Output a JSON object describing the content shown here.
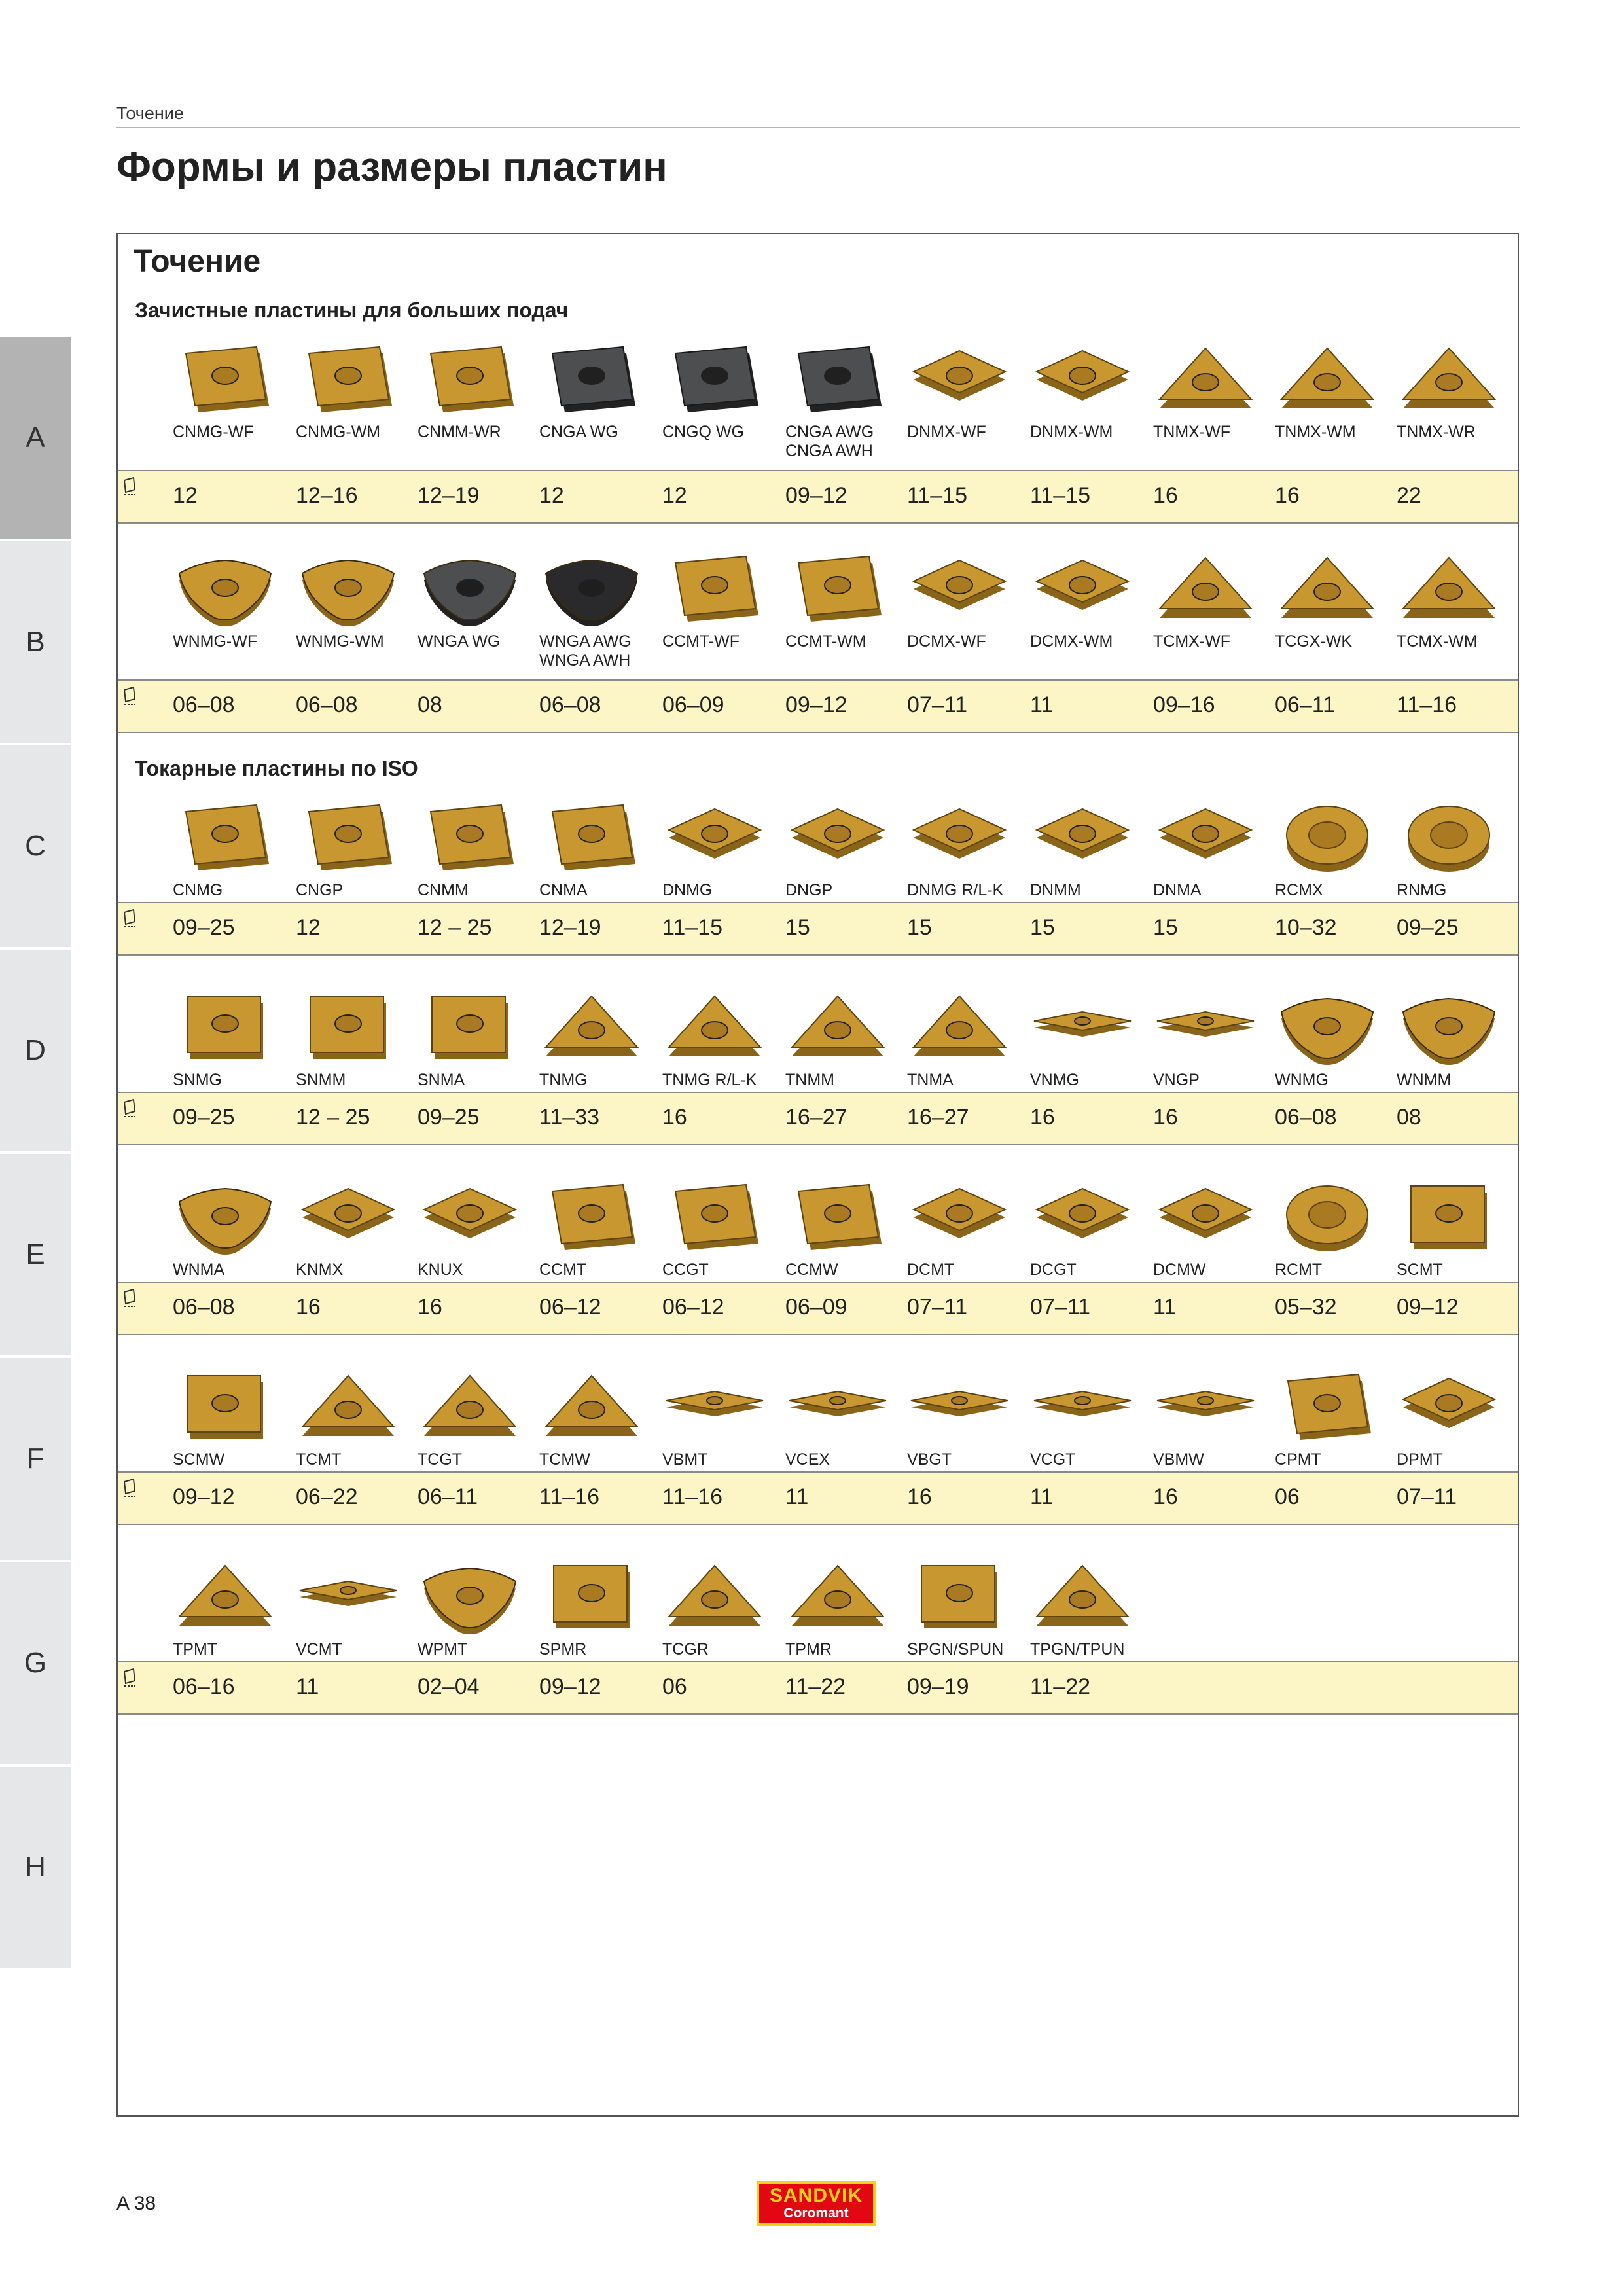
{
  "header": {
    "section": "Точение",
    "title": "Формы и размеры пластин"
  },
  "side_tabs": [
    "A",
    "B",
    "C",
    "D",
    "E",
    "F",
    "G",
    "H"
  ],
  "content": {
    "title": "Точение",
    "subheadings": [
      "Зачистные пластины для больших подач",
      "Токарные пластины по ISO"
    ]
  },
  "groups": [
    {
      "items": [
        {
          "code": "CNMG-WF",
          "value": "12",
          "shape": "rhombus80",
          "color": "gold"
        },
        {
          "code": "CNMG-WM",
          "value": "12–16",
          "shape": "rhombus80",
          "color": "gold"
        },
        {
          "code": "CNMM-WR",
          "value": "12–19",
          "shape": "rhombus80",
          "color": "gold"
        },
        {
          "code": "CNGA WG",
          "value": "12",
          "shape": "rhombus80",
          "color": "dark"
        },
        {
          "code": "CNGQ WG",
          "value": "12",
          "shape": "rhombus80",
          "color": "dark"
        },
        {
          "code": "CNGA AWG\nCNGA AWH",
          "value": "09–12",
          "shape": "rhombus80",
          "color": "dark"
        },
        {
          "code": "DNMX-WF",
          "value": "11–15",
          "shape": "rhombus55",
          "color": "gold"
        },
        {
          "code": "DNMX-WM",
          "value": "11–15",
          "shape": "rhombus55",
          "color": "gold"
        },
        {
          "code": "TNMX-WF",
          "value": "16",
          "shape": "triangle",
          "color": "gold"
        },
        {
          "code": "TNMX-WM",
          "value": "16",
          "shape": "triangle",
          "color": "gold"
        },
        {
          "code": "TNMX-WR",
          "value": "22",
          "shape": "triangle",
          "color": "gold"
        }
      ]
    },
    {
      "items": [
        {
          "code": "WNMG-WF",
          "value": "06–08",
          "shape": "trigon",
          "color": "gold"
        },
        {
          "code": "WNMG-WM",
          "value": "06–08",
          "shape": "trigon",
          "color": "gold"
        },
        {
          "code": "WNGA WG",
          "value": "08",
          "shape": "trigon",
          "color": "dark"
        },
        {
          "code": "WNGA AWG\nWNGA AWH",
          "value": "06–08",
          "shape": "trigon",
          "color": "black"
        },
        {
          "code": "CCMT-WF",
          "value": "06–09",
          "shape": "rhombus80",
          "color": "gold"
        },
        {
          "code": "CCMT-WM",
          "value": "09–12",
          "shape": "rhombus80",
          "color": "gold"
        },
        {
          "code": "DCMX-WF",
          "value": "07–11",
          "shape": "rhombus55",
          "color": "gold"
        },
        {
          "code": "DCMX-WM",
          "value": "11",
          "shape": "rhombus55",
          "color": "gold"
        },
        {
          "code": "TCMX-WF",
          "value": "09–16",
          "shape": "triangle",
          "color": "gold"
        },
        {
          "code": "TCGX-WK",
          "value": "06–11",
          "shape": "triangle",
          "color": "gold"
        },
        {
          "code": "TCMX-WM",
          "value": "11–16",
          "shape": "triangle",
          "color": "gold"
        }
      ]
    },
    {
      "items": [
        {
          "code": "CNMG",
          "value": "09–25",
          "shape": "rhombus80",
          "color": "gold"
        },
        {
          "code": "CNGP",
          "value": "12",
          "shape": "rhombus80",
          "color": "gold"
        },
        {
          "code": "CNMM",
          "value": "12 – 25",
          "shape": "rhombus80",
          "color": "gold"
        },
        {
          "code": "CNMA",
          "value": "12–19",
          "shape": "rhombus80",
          "color": "gold"
        },
        {
          "code": "DNMG",
          "value": "11–15",
          "shape": "rhombus55",
          "color": "gold"
        },
        {
          "code": "DNGP",
          "value": "15",
          "shape": "rhombus55",
          "color": "gold"
        },
        {
          "code": "DNMG R/L-K",
          "value": "15",
          "shape": "rhombus55",
          "color": "gold"
        },
        {
          "code": "DNMM",
          "value": "15",
          "shape": "rhombus55",
          "color": "gold"
        },
        {
          "code": "DNMA",
          "value": "15",
          "shape": "rhombus55",
          "color": "gold"
        },
        {
          "code": "RCMX",
          "value": "10–32",
          "shape": "round",
          "color": "gold"
        },
        {
          "code": "RNMG",
          "value": "09–25",
          "shape": "round",
          "color": "gold"
        }
      ]
    },
    {
      "items": [
        {
          "code": "SNMG",
          "value": "09–25",
          "shape": "square",
          "color": "gold"
        },
        {
          "code": "SNMM",
          "value": "12 – 25",
          "shape": "square",
          "color": "gold"
        },
        {
          "code": "SNMA",
          "value": "09–25",
          "shape": "square",
          "color": "gold"
        },
        {
          "code": "TNMG",
          "value": "11–33",
          "shape": "triangle",
          "color": "gold"
        },
        {
          "code": "TNMG R/L-K",
          "value": "16",
          "shape": "triangle",
          "color": "gold"
        },
        {
          "code": "TNMM",
          "value": "16–27",
          "shape": "triangle",
          "color": "gold"
        },
        {
          "code": "TNMA",
          "value": "16–27",
          "shape": "triangle",
          "color": "gold"
        },
        {
          "code": "VNMG",
          "value": "16",
          "shape": "rhombus35",
          "color": "gold"
        },
        {
          "code": "VNGP",
          "value": "16",
          "shape": "rhombus35",
          "color": "gold"
        },
        {
          "code": "WNMG",
          "value": "06–08",
          "shape": "trigon",
          "color": "gold"
        },
        {
          "code": "WNMM",
          "value": "08",
          "shape": "trigon",
          "color": "gold"
        }
      ]
    },
    {
      "items": [
        {
          "code": "WNMA",
          "value": "06–08",
          "shape": "trigon",
          "color": "gold"
        },
        {
          "code": "KNMX",
          "value": "16",
          "shape": "rhombus55",
          "color": "gold"
        },
        {
          "code": "KNUX",
          "value": "16",
          "shape": "rhombus55",
          "color": "gold"
        },
        {
          "code": "CCMT",
          "value": "06–12",
          "shape": "rhombus80",
          "color": "gold"
        },
        {
          "code": "CCGT",
          "value": "06–12",
          "shape": "rhombus80",
          "color": "gold"
        },
        {
          "code": "CCMW",
          "value": "06–09",
          "shape": "rhombus80",
          "color": "gold"
        },
        {
          "code": "DCMT",
          "value": "07–11",
          "shape": "rhombus55",
          "color": "gold"
        },
        {
          "code": "DCGT",
          "value": "07–11",
          "shape": "rhombus55",
          "color": "gold"
        },
        {
          "code": "DCMW",
          "value": "11",
          "shape": "rhombus55",
          "color": "gold"
        },
        {
          "code": "RCMT",
          "value": "05–32",
          "shape": "round",
          "color": "gold"
        },
        {
          "code": "SCMT",
          "value": "09–12",
          "shape": "square",
          "color": "gold"
        }
      ]
    },
    {
      "items": [
        {
          "code": "SCMW",
          "value": "09–12",
          "shape": "square",
          "color": "gold"
        },
        {
          "code": "TCMT",
          "value": "06–22",
          "shape": "triangle",
          "color": "gold"
        },
        {
          "code": "TCGT",
          "value": "06–11",
          "shape": "triangle",
          "color": "gold"
        },
        {
          "code": "TCMW",
          "value": "11–16",
          "shape": "triangle",
          "color": "gold"
        },
        {
          "code": "VBMT",
          "value": "11–16",
          "shape": "rhombus35",
          "color": "gold"
        },
        {
          "code": "VCEX",
          "value": "11",
          "shape": "rhombus35",
          "color": "gold"
        },
        {
          "code": "VBGT",
          "value": "16",
          "shape": "rhombus35",
          "color": "gold"
        },
        {
          "code": "VCGT",
          "value": "11",
          "shape": "rhombus35",
          "color": "gold"
        },
        {
          "code": "VBMW",
          "value": "16",
          "shape": "rhombus35",
          "color": "gold"
        },
        {
          "code": "CPMT",
          "value": "06",
          "shape": "rhombus80",
          "color": "gold"
        },
        {
          "code": "DPMT",
          "value": "07–11",
          "shape": "rhombus55",
          "color": "gold"
        }
      ]
    },
    {
      "items": [
        {
          "code": "TPMT",
          "value": "06–16",
          "shape": "triangle",
          "color": "gold"
        },
        {
          "code": "VCMT",
          "value": "11",
          "shape": "rhombus35",
          "color": "gold"
        },
        {
          "code": "WPMT",
          "value": "02–04",
          "shape": "trigon",
          "color": "gold"
        },
        {
          "code": "SPMR",
          "value": "09–12",
          "shape": "square",
          "color": "gold"
        },
        {
          "code": "TCGR",
          "value": "06",
          "shape": "triangle",
          "color": "gold"
        },
        {
          "code": "TPMR",
          "value": "11–22",
          "shape": "triangle",
          "color": "gold"
        },
        {
          "code": "SPGN/SPUN",
          "value": "09–19",
          "shape": "square",
          "color": "gold"
        },
        {
          "code": "TPGN/TPUN",
          "value": "11–22",
          "shape": "triangle",
          "color": "gold"
        }
      ]
    }
  ],
  "footer": {
    "page": "A 38",
    "logo_line1": "SANDVIK",
    "logo_line2": "Coromant"
  },
  "colors": {
    "gold": "#c9972f",
    "gold_dark": "#8a6418",
    "dark": "#4d4e50",
    "black": "#2a2a2c",
    "value_row_bg": "#fcf6c6",
    "logo_red": "#e30613",
    "logo_yellow": "#f7d117"
  }
}
